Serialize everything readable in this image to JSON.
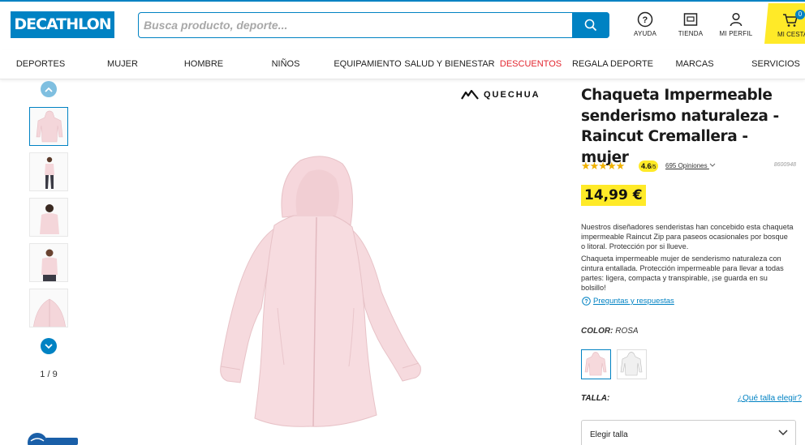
{
  "header": {
    "logo": "DECATHLON",
    "search_placeholder": "Busca producto, deporte...",
    "actions": [
      {
        "label": "AYUDA",
        "icon": "help-icon"
      },
      {
        "label": "TIENDA",
        "icon": "store-icon"
      },
      {
        "label": "MI PERFIL",
        "icon": "user-icon"
      }
    ],
    "cart": {
      "label": "MI CESTA",
      "count": "0"
    }
  },
  "nav": {
    "items": [
      "DEPORTES",
      "MUJER",
      "HOMBRE",
      "NIÑOS",
      "EQUIPAMIENTO",
      "SALUD Y BIENESTAR",
      "DESCUENTOS",
      "REGALA DEPORTE",
      "MARCAS",
      "SERVICIOS"
    ]
  },
  "gallery": {
    "pager": "1 / 9"
  },
  "brand": {
    "name": "QUECHUA"
  },
  "product": {
    "title": "Chaqueta Impermeable senderismo naturaleza - Raincut Cremallera - mujer",
    "stars": "★★★★★",
    "rating": "4.6",
    "rating_max": "/5",
    "reviews": "695 Opiniones",
    "sku": "8600948",
    "price": "14,99 €",
    "description_1": "Nuestros diseñadores senderistas han concebido esta chaqueta impermeable Raincut Zip para paseos ocasionales por bosque o litoral. Protección por si llueve.",
    "description_2": "Chaqueta impermeable mujer de senderismo naturaleza con cintura entallada. Protección impermeable para llevar a todas partes: ligera, compacta y transpirable, ¡se guarda en su bolsillo!",
    "qa_link": "Preguntas y respuestas",
    "color_label": "COLOR:",
    "color_value": "ROSA",
    "size_label": "TALLA:",
    "size_guide": "¿Qué talla elegir?",
    "size_select": "Elegir talla"
  },
  "colors": {
    "accent": "#0082c3",
    "highlight": "#ffea28",
    "sale": "#e3262f",
    "jacket": "#f6d9dc"
  }
}
